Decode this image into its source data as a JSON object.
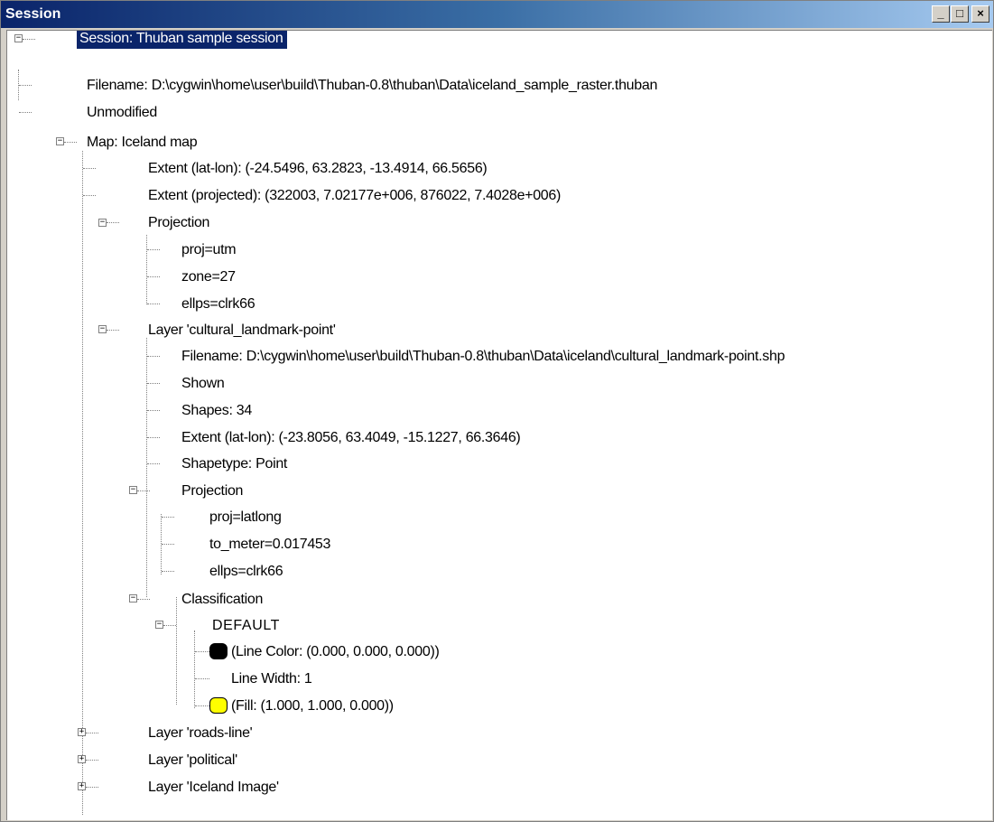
{
  "window": {
    "title": "Session"
  },
  "controls": {
    "minimize": "_",
    "maximize": "□",
    "close": "×"
  },
  "tree": {
    "root": "Session: Thuban sample session",
    "filename": "Filename: D:\\cygwin\\home\\user\\build\\Thuban-0.8\\thuban\\Data\\iceland_sample_raster.thuban",
    "modified": "Unmodified",
    "map": {
      "label": "Map: Iceland map",
      "extent_latlon": "Extent (lat-lon): (-24.5496, 63.2823, -13.4914, 66.5656)",
      "extent_projected": "Extent (projected): (322003, 7.02177e+006, 876022, 7.4028e+006)",
      "projection": {
        "label": "Projection",
        "items": [
          "proj=utm",
          "zone=27",
          "ellps=clrk66"
        ]
      },
      "layer1": {
        "label": "Layer 'cultural_landmark-point'",
        "filename": "Filename: D:\\cygwin\\home\\user\\build\\Thuban-0.8\\thuban\\Data\\iceland\\cultural_landmark-point.shp",
        "shown": "Shown",
        "shapes": "Shapes: 34",
        "extent": "Extent (lat-lon): (-23.8056, 63.4049, -15.1227, 66.3646)",
        "shapetype": "Shapetype: Point",
        "projection": {
          "label": "Projection",
          "items": [
            "proj=latlong",
            "to_meter=0.017453",
            "ellps=clrk66"
          ]
        },
        "classification": {
          "label": "Classification",
          "default": {
            "label": "DEFAULT",
            "line_color": "(Line Color: (0.000, 0.000, 0.000))",
            "line_color_swatch": "#000000",
            "line_width": "Line Width: 1",
            "fill": "(Fill: (1.000, 1.000, 0.000))",
            "fill_swatch": "#ffff00"
          }
        }
      },
      "other_layers": [
        "Layer 'roads-line'",
        "Layer 'political'",
        "Layer 'Iceland Image'"
      ]
    }
  }
}
